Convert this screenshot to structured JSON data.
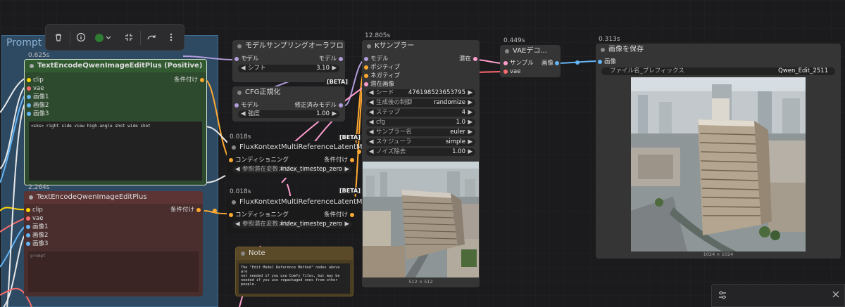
{
  "canvas": {
    "background": "#1b1b1d"
  },
  "group": {
    "title": "Prompt"
  },
  "toolbar": {
    "icons": [
      "trash-icon",
      "info-icon",
      "color-circle-icon",
      "fit-icon",
      "bypass-icon",
      "more-icon"
    ],
    "color": "#2f7d32"
  },
  "nodes": {
    "encode_pos": {
      "time": "0.625s",
      "title": "TextEncodeQwenImageEditPlus (Positive)",
      "inputs": [
        "clip",
        "vae",
        "画像1",
        "画像2",
        "画像3"
      ],
      "output": "条件付け",
      "prompt": "<sks> right side view high-angle shot wide shot"
    },
    "encode_neg": {
      "time": "2.264s",
      "title": "TextEncodeQwenImageEditPlus",
      "inputs": [
        "clip",
        "vae",
        "画像1",
        "画像2",
        "画像3"
      ],
      "output": "条件付け",
      "placeholder": "prompt"
    },
    "model_sampling": {
      "title": "モデルサンプリングオーラフロー",
      "input": "モデル",
      "output": "モデル",
      "widget_label": "シフト",
      "widget_value": "3.10",
      "badge": "[BETA]"
    },
    "cfg_norm": {
      "title": "CFG正規化",
      "input": "モデル",
      "output": "修正済みモデル",
      "widget_label": "強度",
      "widget_value": "1.00",
      "badge": "[BETA]"
    },
    "flux1": {
      "time": "0.018s",
      "title": "FluxKontextMultiReferenceLatentM...",
      "input": "コンディショニング",
      "output": "条件付け",
      "widget_label": "参照潜在変数メソ...",
      "widget_value": "index_timestep_zero",
      "badge": "[BETA]"
    },
    "flux2": {
      "time": "0.018s",
      "title": "FluxKontextMultiReferenceLatentM...",
      "input": "コンディショニング",
      "output": "条件付け",
      "widget_label": "参照潜在変数メソ...",
      "widget_value": "index_timestep_zero"
    },
    "note": {
      "title": "Note",
      "text": "The \"Edit Model Reference Method\" nodes above are\nnot needed if you use Comfy files, but may be\nneeded if you use repackaged ones from other\npeople."
    },
    "ksampler": {
      "time": "12.805s",
      "title": "Kサンプラー",
      "inputs": [
        "モデル",
        "ポジティブ",
        "ネガティブ",
        "潜在画像"
      ],
      "output": "潜在",
      "widgets": [
        {
          "label": "シード",
          "value": "476198523653795"
        },
        {
          "label": "生成後の制御",
          "value": "randomize"
        },
        {
          "label": "ステップ",
          "value": "4"
        },
        {
          "label": "cfg",
          "value": "1.0"
        },
        {
          "label": "サンプラー名",
          "value": "euler"
        },
        {
          "label": "スケジューラ",
          "value": "simple"
        },
        {
          "label": "ノイズ除去",
          "value": "1.00"
        }
      ],
      "dims": "512 × 512"
    },
    "vae": {
      "time": "0.449s",
      "title": "VAEデコ...",
      "inputs": [
        "サンプル",
        "vae"
      ],
      "output": "画像"
    },
    "save": {
      "time": "0.313s",
      "title": "画像を保存",
      "input": "画像",
      "widget_label": "ファイル名_プレフィックス",
      "widget_value": "Qwen_Edit_2511",
      "dims": "1024 × 1024"
    }
  }
}
